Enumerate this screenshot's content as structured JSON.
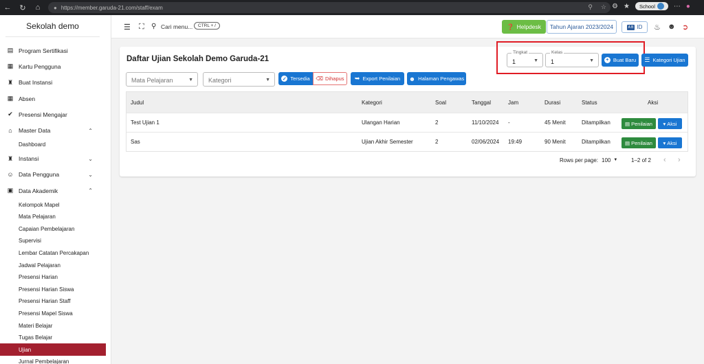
{
  "browser": {
    "url": "https://member.garuda-21.com/staff/exam",
    "profile": "School"
  },
  "sidebar": {
    "title": "Sekolah demo",
    "items": [
      {
        "label": "Program Sertifikasi",
        "icon": "certificate-icon"
      },
      {
        "label": "Kartu Pengguna",
        "icon": "id-card-icon"
      },
      {
        "label": "Buat Instansi",
        "icon": "building-icon"
      },
      {
        "label": "Absen",
        "icon": "calendar-icon"
      },
      {
        "label": "Presensi Mengajar",
        "icon": "check-circle-icon"
      },
      {
        "label": "Master Data",
        "icon": "home-icon"
      }
    ],
    "master_sub": [
      "Dashboard"
    ],
    "instansi": "Instansi",
    "data_pengguna": "Data Pengguna",
    "data_akademik": "Data Akademik",
    "akademik_sub": [
      "Kelompok Mapel",
      "Mata Pelajaran",
      "Capaian Pembelajaran",
      "Supervisi",
      "Lembar Catatan Percakapan",
      "Jadwal Pelajaran",
      "Presensi Harian",
      "Presensi Harian Siswa",
      "Presensi Harian Staff",
      "Presensi Mapel Siswa",
      "Materi Belajar",
      "Tugas Belajar",
      "Ujian",
      "Jurnal Pembelajaran"
    ]
  },
  "topbar": {
    "search": "Cari menu...",
    "shortcut": "CTRL + /",
    "helpdesk": "Helpdesk",
    "year": "Tahun Ajaran 2023/2024",
    "lang_flag": "A B",
    "lang": "ID"
  },
  "page": {
    "title": "Daftar Ujian Sekolah Demo Garuda-21",
    "tingkat_label": "Tingkat",
    "tingkat_value": "1",
    "kelas_label": "Kelas",
    "kelas_value": "1",
    "buat_baru": "Buat Baru",
    "kategori_ujian": "Kategori Ujian",
    "mapel_placeholder": "Mata Pelajaran",
    "kategori_placeholder": "Kategori",
    "tersedia": "Tersedia",
    "dihapus": "Dihapus",
    "export": "Export Penilaian",
    "pengawas": "Halaman Pengawas"
  },
  "table": {
    "headers": [
      "Judul",
      "Kategori",
      "Soal",
      "Tanggal",
      "Jam",
      "Durasi",
      "Status",
      "Aksi"
    ],
    "rows": [
      [
        "Test Ujian 1",
        "Ulangan Harian",
        "2",
        "11/10/2024",
        "-",
        "45 Menit",
        "Ditampilkan"
      ],
      [
        "Sas",
        "Ujian Akhir Semester",
        "2",
        "02/06/2024",
        "19:49",
        "90 Menit",
        "Ditampilkan"
      ]
    ],
    "penilaian_label": "Penilaian",
    "aksi_label": "Aksi",
    "rows_per_page_label": "Rows per page:",
    "rows_per_page": "100",
    "range": "1–2 of 2"
  },
  "colors": {
    "active_sidebar": "#a3202f",
    "primary": "#1976d2",
    "success": "#2e8b3e",
    "helpdesk": "#6cbd45",
    "highlight": "#e01b24"
  }
}
